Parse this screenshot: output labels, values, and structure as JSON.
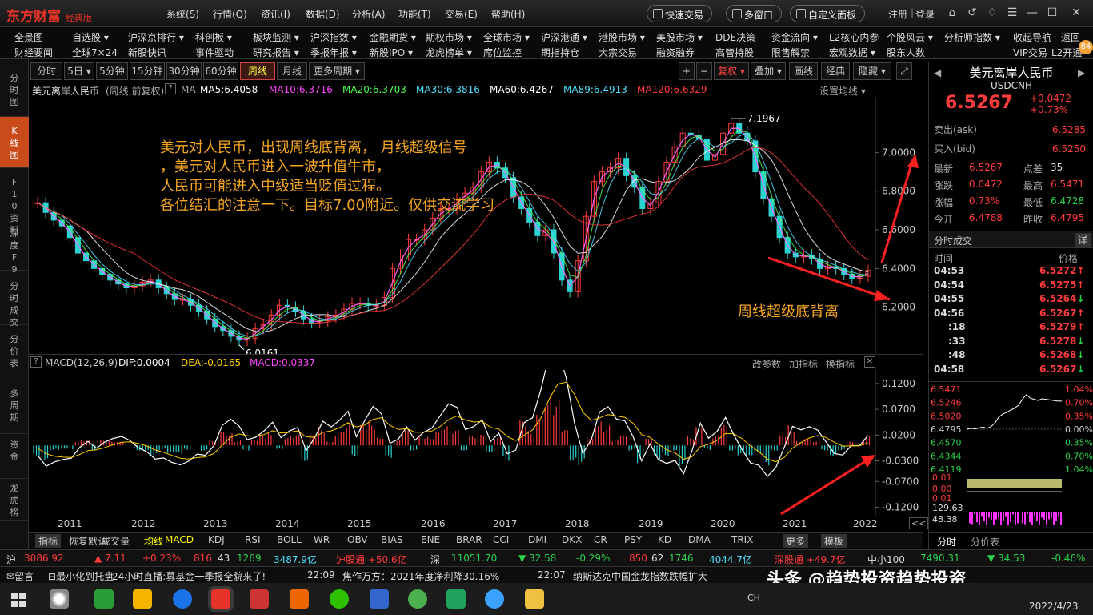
{
  "app": {
    "logo": "东方财富",
    "edition": "经典版",
    "menus": [
      "系统(S)",
      "行情(Q)",
      "资讯(I)",
      "数据(D)",
      "分析(A)",
      "功能(T)",
      "交易(E)",
      "帮助(H)"
    ],
    "quick_trade": "快速交易",
    "multi_window": "多窗口",
    "custom_panel": "自定义面板",
    "register": "注册",
    "login": "登录"
  },
  "nav": {
    "row1": [
      "全景图",
      "自选股 ▾",
      "沪深京排行 ▾",
      "科创板 ▾",
      "板块监测 ▾",
      "沪深指数 ▾",
      "金融期货 ▾",
      "期权市场 ▾",
      "全球市场 ▾",
      "沪深港通 ▾",
      "港股市场 ▾",
      "美股市场 ▾",
      "DDE决策",
      "资金流向 ▾",
      "L2核心内参",
      "个股风云 ▾",
      "分析师指数 ▾",
      "收起导航",
      "返回"
    ],
    "row2": [
      "财经要闻",
      "全球7×24",
      "新股快讯",
      "事件驱动",
      "研究报告 ▾",
      "季报年报 ▾",
      "新股IPO ▾",
      "龙虎榜单 ▾",
      "席位监控",
      "期指持仓",
      "大宗交易",
      "融资融券",
      "高管持股",
      "限售解禁",
      "宏观数据 ▾",
      "股东人数",
      "VIP交易",
      "L2开通"
    ],
    "badge": "84"
  },
  "leftbar": [
    "分时图",
    "K线图",
    "F10资料",
    "深度F9",
    "分时成交",
    "分价表",
    "多周期",
    "资金",
    "龙虎榜"
  ],
  "toolbar": {
    "periods": [
      "分时",
      "5日 ▾",
      "5分钟",
      "15分钟",
      "30分钟",
      "60分钟",
      "周线",
      "月线",
      "更多周期 ▾"
    ],
    "active": "周线",
    "right": [
      "+",
      "−",
      "复权 ▾",
      "叠加 ▾",
      "画线",
      "经典",
      "隐藏 ▾",
      "⤢"
    ]
  },
  "main_header": {
    "name": "美元离岸人民币",
    "mode": "(周线,前复权)",
    "ma": "MA",
    "ma5": "MA5:6.4058",
    "ma10": "MA10:6.3716",
    "ma20": "MA20:6.3703",
    "ma30": "MA30:6.3816",
    "ma60": "MA60:6.4267",
    "ma89": "MA89:6.4913",
    "ma120": "MA120:6.6329",
    "settings": "设置均线 ▾"
  },
  "annotation": {
    "lines": [
      "美元对人民币，出现周线底背离， 月线超级信号",
      "，美元对人民币进入一波升值牛市，",
      "人民币可能进入中级适当贬值过程。",
      "各位结汇的注意一下。目标7.00附近。仅供交流学习"
    ],
    "divergence": "周线超级底背离",
    "high_label": "7.1967",
    "low_label": "6.0161"
  },
  "macd_header": {
    "name": "MACD(12,26,9)",
    "dif": "DIF:0.0004",
    "dea": "DEA:-0.0165",
    "macd": "MACD:0.0337",
    "params": "改参数",
    "add": "加指标",
    "switch": "换指标"
  },
  "chart_data": [
    {
      "type": "candlestick",
      "title": "美元离岸人民币 周线",
      "y_ticks": [
        7.0,
        6.8,
        6.6,
        6.4,
        6.2
      ],
      "ylim": [
        6.0,
        7.25
      ],
      "x_ticks": [
        "2011",
        "2012",
        "2013",
        "2014",
        "2015",
        "2016",
        "2017",
        "2018",
        "2019",
        "2020",
        "2021",
        "2022"
      ],
      "close": [
        6.74,
        6.69,
        6.65,
        6.62,
        6.56,
        6.48,
        6.44,
        6.4,
        6.37,
        6.34,
        6.32,
        6.3,
        6.31,
        6.33,
        6.34,
        6.3,
        6.27,
        6.24,
        6.24,
        6.21,
        6.18,
        6.14,
        6.1,
        6.08,
        6.05,
        6.03,
        6.04,
        6.09,
        6.11,
        6.16,
        6.21,
        6.2,
        6.18,
        6.14,
        6.12,
        6.13,
        6.15,
        6.16,
        6.19,
        6.22,
        6.22,
        6.21,
        6.21,
        6.25,
        6.4,
        6.47,
        6.55,
        6.55,
        6.6,
        6.66,
        6.71,
        6.71,
        6.76,
        6.79,
        6.82,
        6.9,
        6.95,
        6.92,
        6.87,
        6.77,
        6.71,
        6.64,
        6.57,
        6.6,
        6.48,
        6.34,
        6.28,
        6.44,
        6.67,
        6.85,
        6.9,
        6.92,
        6.97,
        6.88,
        6.82,
        6.71,
        6.74,
        6.85,
        6.95,
        7.03,
        7.1,
        7.09,
        7.07,
        6.96,
        6.99,
        7.1,
        7.15,
        7.1,
        7.06,
        6.9,
        6.76,
        6.67,
        6.56,
        6.48,
        6.46,
        6.47,
        6.45,
        6.4,
        6.41,
        6.4,
        6.37,
        6.35,
        6.36,
        6.39
      ],
      "series": [
        {
          "name": "MA5",
          "value": 6.4058
        },
        {
          "name": "MA10",
          "value": 6.3716
        },
        {
          "name": "MA20",
          "value": 6.3703
        },
        {
          "name": "MA30",
          "value": 6.3816
        },
        {
          "name": "MA60",
          "value": 6.4267
        },
        {
          "name": "MA89",
          "value": 6.4913
        },
        {
          "name": "MA120",
          "value": 6.6329
        }
      ],
      "annotations": [
        {
          "text": "7.1967",
          "kind": "high"
        },
        {
          "text": "6.0161",
          "kind": "low"
        },
        {
          "text": "周线超级底背离"
        }
      ]
    },
    {
      "type": "bar",
      "title": "MACD(12,26,9)",
      "y_ticks": [
        0.12,
        0.07,
        0.02,
        -0.03,
        -0.07,
        -0.12
      ],
      "ylim": [
        -0.13,
        0.14
      ],
      "values": [
        -0.02,
        -0.03,
        -0.01,
        -0.01,
        -0.01,
        0.01,
        0.01,
        -0.01,
        0.01,
        0.01,
        0.01,
        0.0,
        -0.01,
        -0.01,
        -0.02,
        -0.01,
        -0.02,
        -0.02,
        -0.01,
        0.0,
        -0.01,
        0.01,
        0.04,
        0.03,
        0.01,
        -0.01,
        0.01,
        0.02,
        0.03,
        -0.01,
        0.02,
        0.02,
        -0.03,
        0.02,
        0.04,
        0.01,
        0.03,
        0.04,
        -0.02,
        0.04,
        0.05,
        0.02,
        -0.03,
        0.01,
        0.03,
        -0.01,
        0.02,
        0.02,
        0.04,
        0.05,
        0.03,
        -0.01,
        0.02,
        0.03,
        -0.02,
        0.02,
        -0.03,
        0.0,
        0.05,
        0.03,
        0.08,
        0.12,
        0.09,
        0.03,
        -0.03,
        -0.04,
        0.02,
        0.06,
        0.04,
        0.01,
        0.02,
        -0.01,
        -0.04,
        0.02,
        -0.03,
        -0.02,
        -0.01,
        -0.04,
        0.02,
        0.05,
        -0.01,
        0.02,
        0.04,
        -0.01,
        -0.02,
        -0.03,
        -0.02,
        -0.04,
        -0.01,
        0.02,
        0.04,
        0.01,
        0.02,
        0.01,
        -0.01,
        -0.02,
        -0.01,
        0.01,
        0.0,
        0.02
      ],
      "series": [
        {
          "name": "DIF",
          "value": 0.0004
        },
        {
          "name": "DEA",
          "value": -0.0165
        },
        {
          "name": "MACD",
          "value": 0.0337
        }
      ]
    },
    {
      "type": "line",
      "title": "分时",
      "y_ticks": [
        6.5471,
        6.5246,
        6.502,
        6.4795,
        6.457,
        6.4344,
        6.4119
      ],
      "right_ticks": [
        "1.04%",
        "0.70%",
        "0.35%",
        "0.00%",
        "0.35%",
        "0.70%",
        "1.04%"
      ],
      "values": [
        6.48,
        6.481,
        6.48,
        6.482,
        6.483,
        6.481,
        6.484,
        6.49,
        6.5,
        6.505,
        6.508,
        6.512,
        6.515,
        6.52,
        6.53,
        6.538,
        6.532,
        6.53,
        6.528,
        6.531,
        6.53,
        6.529,
        6.528,
        6.527,
        6.527
      ]
    }
  ],
  "macd_right": {
    "years_scroll": "<<"
  },
  "ind_tabs": [
    "指标",
    "恢复默认",
    "成交量",
    "均线",
    "MACD",
    "KDJ",
    "RSI",
    "BOLL",
    "WR",
    "OBV",
    "BIAS",
    "ENE",
    "BRAR",
    "CCI",
    "DMI",
    "DKX",
    "CR",
    "PSY",
    "KD",
    "DMA",
    "TRIX",
    "更多",
    "模板"
  ],
  "quote": {
    "name": "美元离岸人民币",
    "code": "USDCNH",
    "price": "6.5267",
    "chg": "+0.0472",
    "pct": "+0.73%",
    "ask_label": "卖出(ask)",
    "ask": "6.5285",
    "bid_label": "买入(bid)",
    "bid": "6.5250",
    "rows": [
      [
        "最新",
        "6.5267",
        "点差",
        "35"
      ],
      [
        "涨跌",
        "0.0472",
        "最高",
        "6.5471"
      ],
      [
        "涨幅",
        "0.73%",
        "最低",
        "6.4728"
      ],
      [
        "今开",
        "6.4788",
        "昨收",
        "6.4795"
      ]
    ],
    "ticks_title": "分时成交",
    "ticks_more": "详",
    "ticks_hdr": [
      "时间",
      "价格"
    ],
    "ticks": [
      [
        "04:53",
        "6.5272↑"
      ],
      [
        "04:54",
        "6.5275↑"
      ],
      [
        "04:55",
        "6.5264↓"
      ],
      [
        "04:56",
        "6.5267↑"
      ],
      [
        ":18",
        "6.5279↑"
      ],
      [
        ":33",
        "6.5278↓"
      ],
      [
        ":48",
        "6.5268↓"
      ],
      [
        "04:58",
        "6.5267↓"
      ]
    ],
    "sub_labels": [
      "0.01",
      "0.00",
      "0.01",
      "129.63",
      "48.38"
    ],
    "bottom_tabs": [
      "分时",
      "分价表"
    ]
  },
  "status": {
    "sh": "沪",
    "sh_idx": "3086.92",
    "sh_chg": "▲ 7.11",
    "sh_pct": "+0.23%",
    "sh_up": "816",
    "sh_eq": "43",
    "sh_dn": "1269",
    "sh_amt": "3487.9亿",
    "sh_hk": "沪股通 +50.6亿",
    "sz": "深",
    "sz_idx": "11051.70",
    "sz_chg": "▼ 32.58",
    "sz_pct": "-0.29%",
    "sz_up": "850",
    "sz_eq": "62",
    "sz_dn": "1746",
    "sz_amt": "4044.7亿",
    "sz_hk": "深股通 +49.7亿",
    "zx": "中小100",
    "zx_idx": "7490.31",
    "zx_chg": "▼ 34.53",
    "zx_pct": "-0.46%"
  },
  "news": {
    "msg": "留言",
    "tray": "最小化到托盘",
    "live": "24小时直播:募基金一季报全貌来了!",
    "t1": "22:09",
    "n1": "焦作万方：2021年度净利降30.16%",
    "t2": "22:07",
    "n2": "纳斯达克中国金龙指数跌幅扩大",
    "watermark": "头条 @趋势投资趋势投资"
  },
  "taskbar": {
    "lang": "CH",
    "date": "2022/4/23"
  }
}
